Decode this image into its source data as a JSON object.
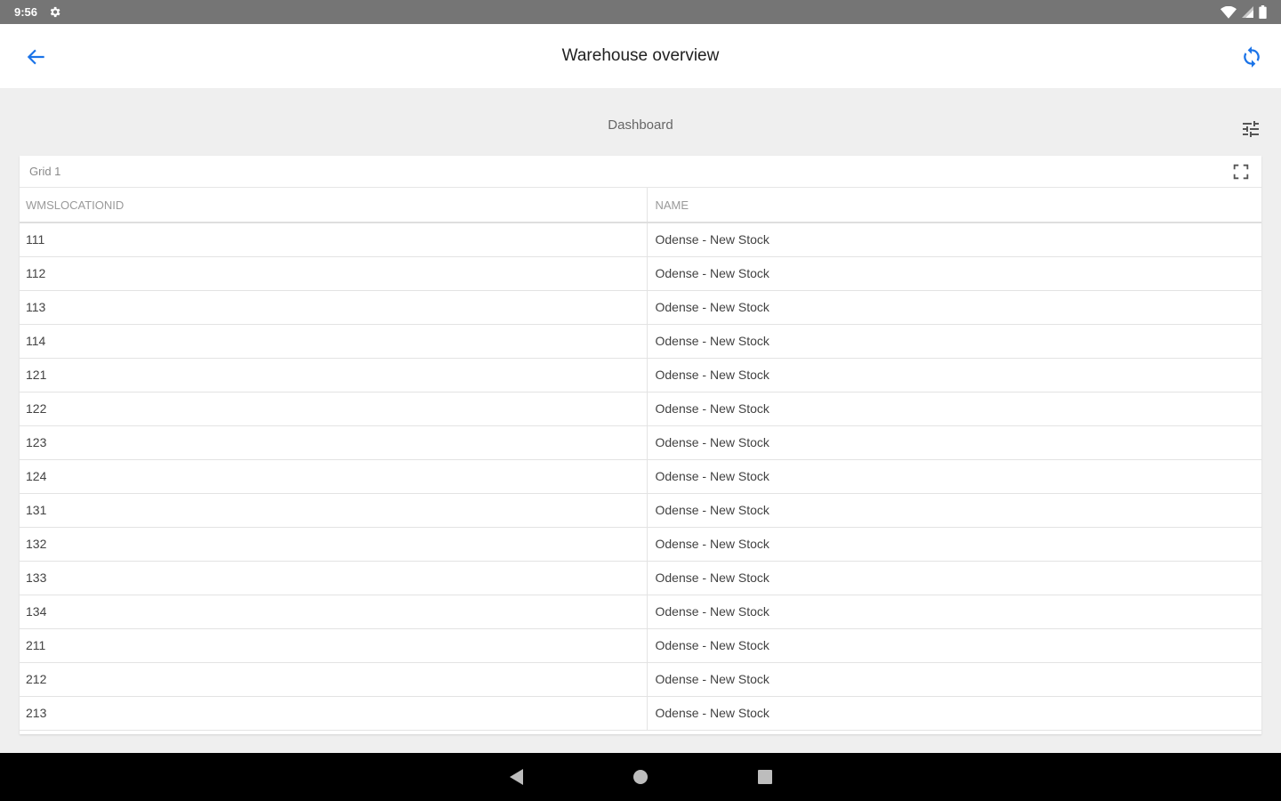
{
  "status_bar": {
    "time": "9:56",
    "icons": [
      "settings-gear-icon",
      "wifi-icon",
      "signal-icon",
      "battery-icon"
    ]
  },
  "app_bar": {
    "title": "Warehouse overview",
    "back_icon": "arrow-back-icon",
    "refresh_icon": "sync-icon"
  },
  "dashboard": {
    "title": "Dashboard",
    "tune_icon": "tune-icon"
  },
  "grid": {
    "title": "Grid 1",
    "fullscreen_icon": "fullscreen-icon",
    "columns": [
      "WMSLOCATIONID",
      "NAME"
    ],
    "rows": [
      [
        "111",
        "Odense - New Stock"
      ],
      [
        "112",
        "Odense - New Stock"
      ],
      [
        "113",
        "Odense - New Stock"
      ],
      [
        "114",
        "Odense - New Stock"
      ],
      [
        "121",
        "Odense - New Stock"
      ],
      [
        "122",
        "Odense - New Stock"
      ],
      [
        "123",
        "Odense - New Stock"
      ],
      [
        "124",
        "Odense - New Stock"
      ],
      [
        "131",
        "Odense - New Stock"
      ],
      [
        "132",
        "Odense - New Stock"
      ],
      [
        "133",
        "Odense - New Stock"
      ],
      [
        "134",
        "Odense - New Stock"
      ],
      [
        "211",
        "Odense - New Stock"
      ],
      [
        "212",
        "Odense - New Stock"
      ],
      [
        "213",
        "Odense - New Stock"
      ]
    ]
  },
  "nav_bar": {
    "icons": [
      "back-triangle-icon",
      "home-circle-icon",
      "recents-square-icon"
    ]
  },
  "colors": {
    "accent": "#1a73e8",
    "status_bar": "#757575",
    "background": "#efefef"
  }
}
